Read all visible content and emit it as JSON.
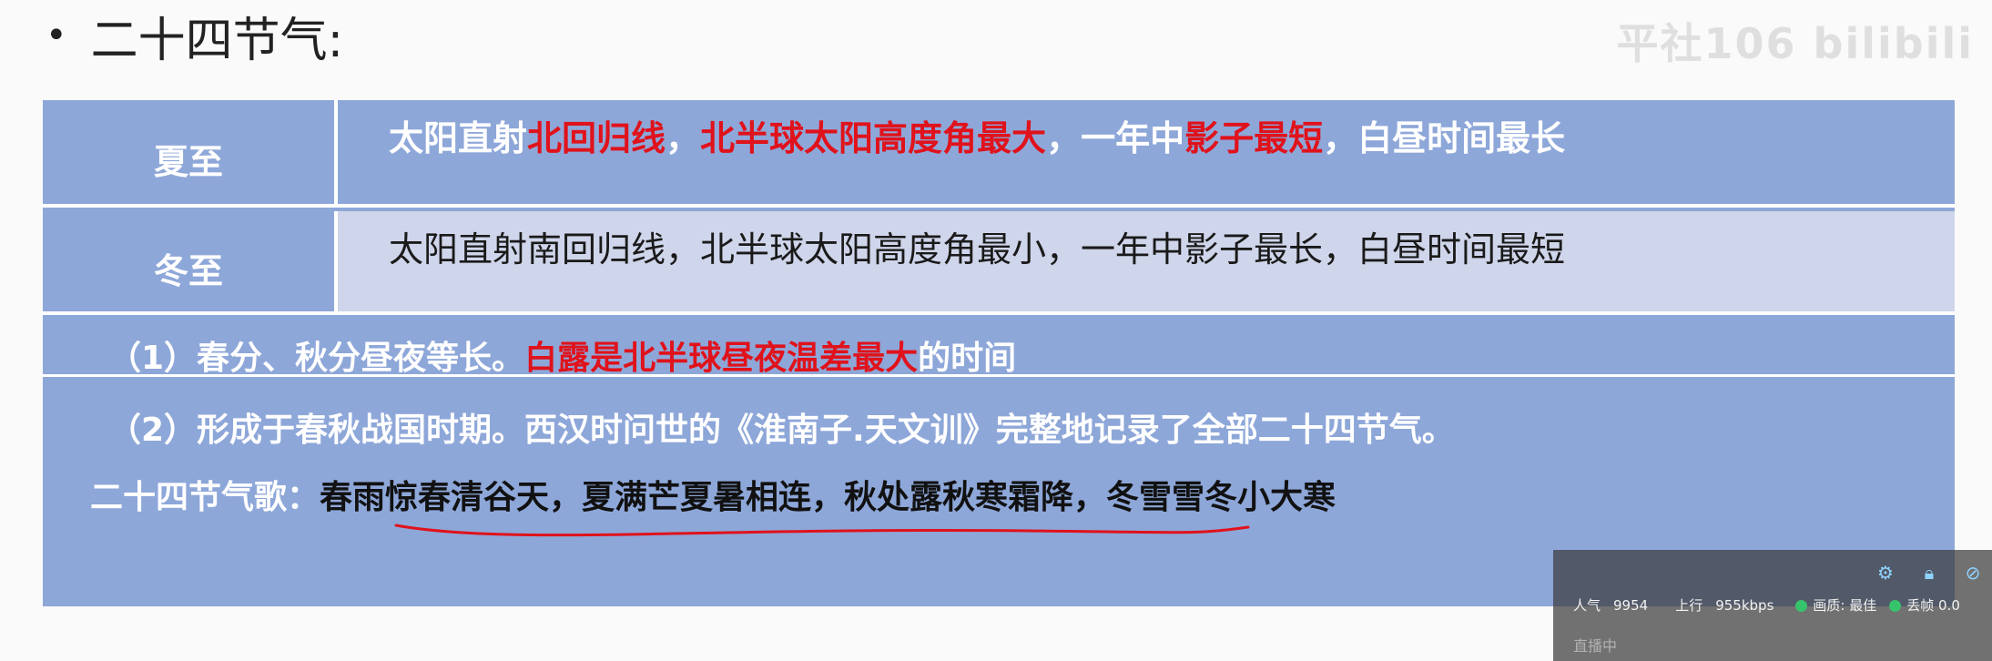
{
  "slide": {
    "heading": "二十四节气:",
    "bullet": "•",
    "watermark": "平社106  bilibili"
  },
  "table": {
    "row_summer": {
      "label": "夏至",
      "parts": [
        "太阳直射",
        "北回归线",
        "，",
        "北半球太阳高度角最大",
        "，一年中",
        "影子最短",
        "，白昼时间最长"
      ]
    },
    "row_winter": {
      "label": "冬至",
      "text": "太阳直射南回归线，北半球太阳高度角最小，一年中影子最长，白昼时间最短"
    },
    "row_equinox": {
      "parts": [
        "（1）春分、秋分昼夜等长。",
        "白露是北半球昼夜温差最大",
        "的时间"
      ]
    },
    "row_history": {
      "line1": "（2）形成于春秋战国时期。西汉时问世的《淮南子.天文训》完整地记录了全部二十四节气。",
      "song_label": "二十四节气歌：",
      "song_text": "春雨惊春清谷天，夏满芒夏暑相连，秋处露秋寒霜降，冬雪雪冬小大寒"
    }
  },
  "overlay": {
    "icons": [
      "gear-icon",
      "lock-icon",
      "link-icon"
    ],
    "popularity_label": "人气",
    "popularity_value": "9954",
    "upload_label": "上行",
    "upload_value": "955kbps",
    "quality_label": "画质: 最佳",
    "frame_label": "丢帧 0.0",
    "bottom_text": "直播中",
    "status_color": "#36c36b"
  }
}
